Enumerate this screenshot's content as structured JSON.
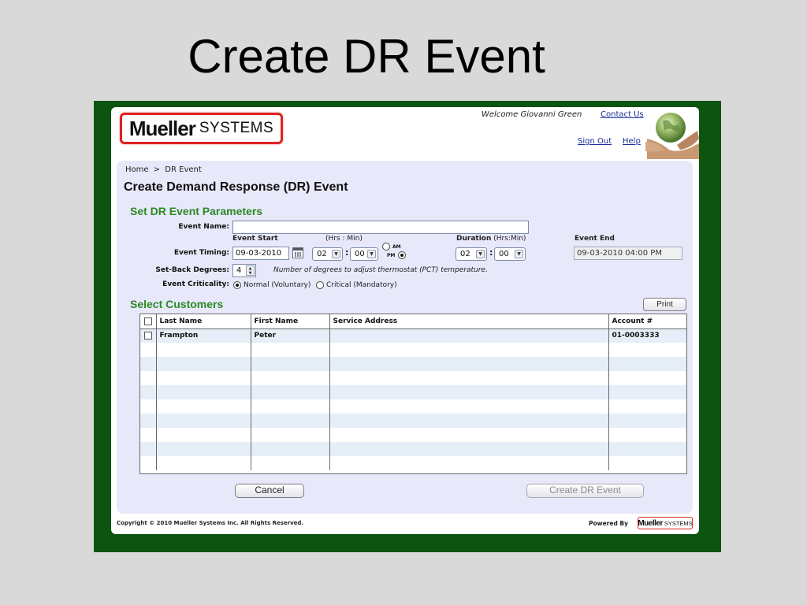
{
  "slide": {
    "title": "Create DR Event"
  },
  "header": {
    "logo_brand": "Mueller",
    "logo_suffix": "SYSTEMS",
    "welcome": "Welcome Giovanni Green",
    "contact_us": "Contact Us",
    "sign_out": "Sign Out",
    "help": "Help"
  },
  "breadcrumb": {
    "home": "Home",
    "sep": ">",
    "current": "DR Event"
  },
  "page_title": "Create Demand Response (DR) Event",
  "params": {
    "section_title": "Set DR Event Parameters",
    "event_name_label": "Event Name:",
    "event_name_value": "",
    "event_start_label": "Event Start",
    "hrs_min_label": "(Hrs : Min)",
    "duration_label": "Duration",
    "duration_unit": "(Hrs:Min)",
    "event_end_label": "Event End",
    "event_timing_label": "Event Timing:",
    "start_date": "09-03-2010",
    "start_hour": "02",
    "start_minute": "00",
    "am_label": "AM",
    "pm_label": "PM",
    "ampm_selected": "PM",
    "duration_hours": "02",
    "duration_minutes": "00",
    "event_end_value": "09-03-2010 04:00 PM",
    "setback_label": "Set-Back Degrees:",
    "setback_value": "4",
    "setback_hint": "Number of degrees to adjust thermostat (PCT) temperature.",
    "criticality_label": "Event Criticality:",
    "criticality_options": [
      "Normal (Voluntary)",
      "Critical (Mandatory)"
    ],
    "criticality_selected": "Normal (Voluntary)"
  },
  "customers": {
    "section_title": "Select Customers",
    "print_label": "Print",
    "columns": [
      "Last Name",
      "First Name",
      "Service Address",
      "Account #"
    ],
    "rows": [
      {
        "last_name": "Frampton",
        "first_name": "Peter",
        "service_address": "",
        "account": "01-0003333",
        "checked": false
      }
    ]
  },
  "actions": {
    "cancel_label": "Cancel",
    "create_label": "Create DR Event"
  },
  "footer": {
    "copyright": "Copyright © 2010 Mueller Systems Inc.   All Rights Reserved.",
    "powered_by": "Powered By",
    "logo_brand": "Mueller",
    "logo_suffix": "SYSTEMS"
  },
  "colors": {
    "frame_green": "#0d5410",
    "section_green": "#2a8a22",
    "logo_red": "#dd2222",
    "link_blue": "#1b2e9a",
    "panel_lavender": "#e8e8fb"
  }
}
